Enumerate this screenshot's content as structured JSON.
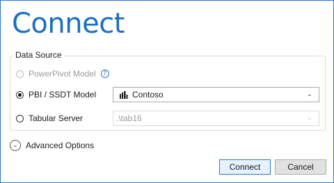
{
  "dialog": {
    "title": "Connect"
  },
  "data_source": {
    "legend": "Data Source",
    "options": [
      {
        "label": "PowerPivot Model",
        "selected": false,
        "enabled": false,
        "help_icon": "question-circle-icon"
      },
      {
        "label": "PBI / SSDT Model",
        "selected": true,
        "enabled": true,
        "combo_value": "Contoso",
        "combo_icon": "power-bi-icon"
      },
      {
        "label": "Tabular Server",
        "selected": false,
        "enabled": true,
        "combo_value": ".\\tab16",
        "combo_enabled": false
      }
    ]
  },
  "advanced": {
    "label": "Advanced Options",
    "icon": "chevron-down-circle-icon"
  },
  "buttons": {
    "connect": "Connect",
    "cancel": "Cancel"
  },
  "colors": {
    "accent": "#1b6fc0",
    "window_border": "#2b78c9",
    "disabled_text": "#9a9a9a"
  }
}
